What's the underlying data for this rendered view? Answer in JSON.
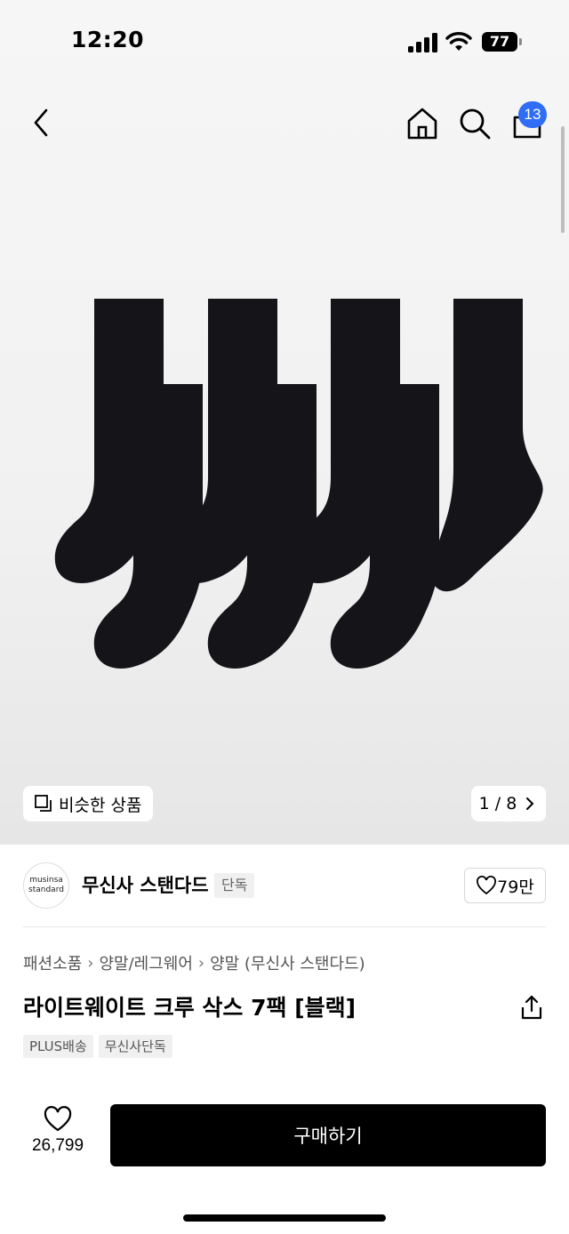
{
  "status_bar": {
    "time": "12:20",
    "battery": "77"
  },
  "header": {
    "cart_count": "13"
  },
  "gallery": {
    "similar_label": "비슷한 상품",
    "page_indicator": "1 / 8"
  },
  "brand": {
    "logo_line1": "musinsa",
    "logo_line2": "standard",
    "name": "무신사 스탠다드",
    "exclusive_tag": "단독",
    "likes": "79만"
  },
  "breadcrumb": [
    "패션소품",
    "양말/레그웨어",
    "양말 (무신사 스탠다드)"
  ],
  "product": {
    "title": "라이트웨이트 크루 삭스 7팩 [블랙]",
    "tags": [
      "PLUS배송",
      "무신사단독"
    ]
  },
  "bottom": {
    "like_count": "26,799",
    "buy_label": "구매하기"
  },
  "colors": {
    "accent": "#2f6df6",
    "buy_button": "#000000",
    "sock": "#141419"
  }
}
